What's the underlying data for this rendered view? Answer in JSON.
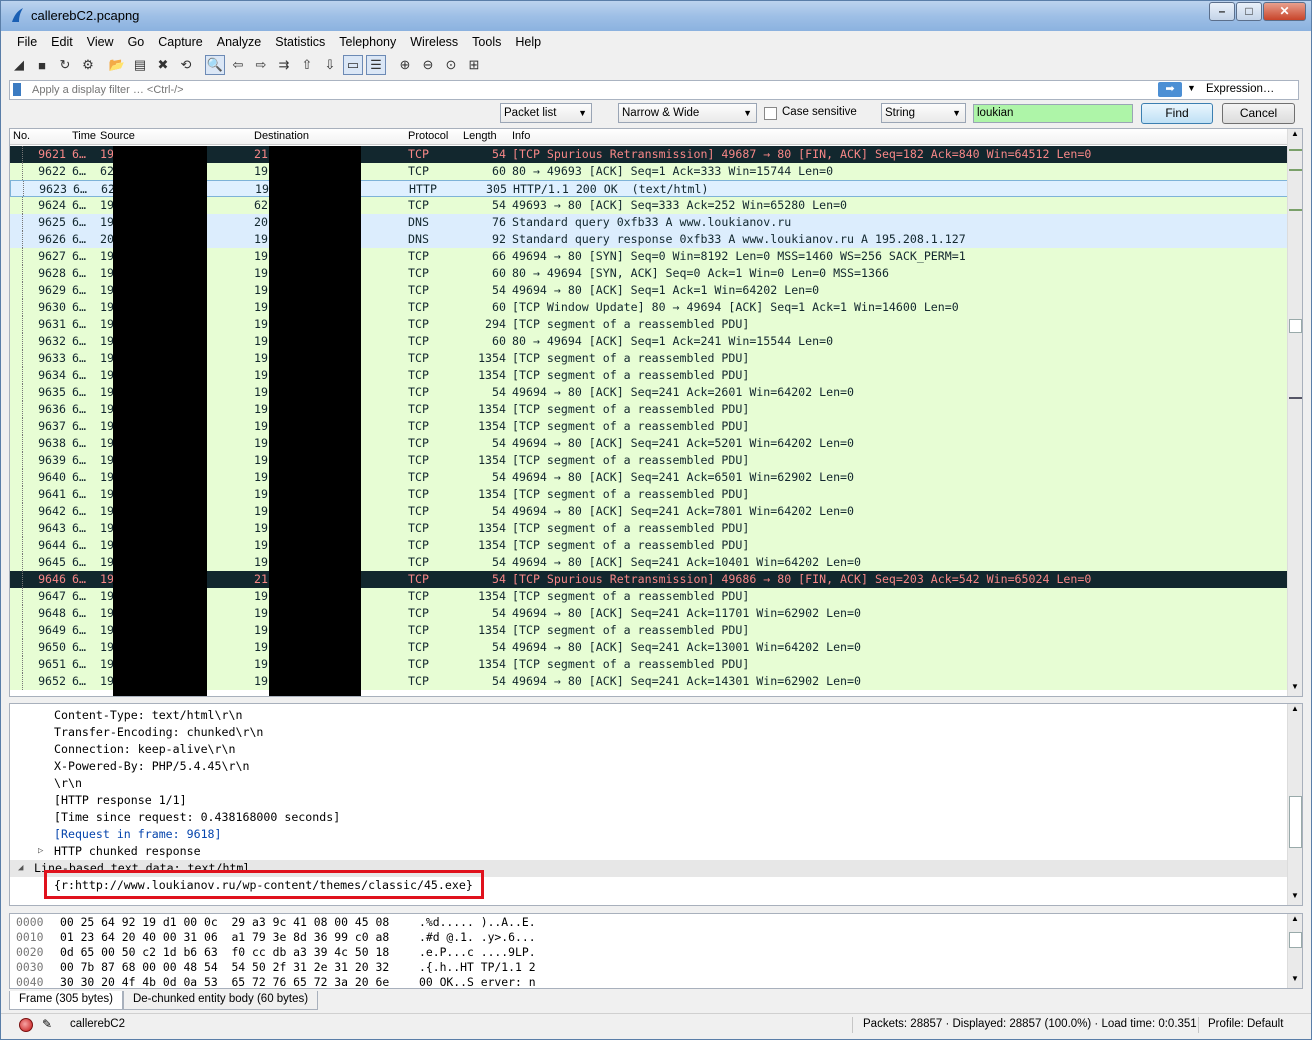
{
  "window": {
    "title": "callerebC2.pcapng",
    "controls": [
      "–",
      "□",
      "✕"
    ]
  },
  "menu": [
    "File",
    "Edit",
    "View",
    "Go",
    "Capture",
    "Analyze",
    "Statistics",
    "Telephony",
    "Wireless",
    "Tools",
    "Help"
  ],
  "toolbar": {
    "icons": [
      "shark-fin-start-icon",
      "stop-icon",
      "restart-icon",
      "options-icon",
      "open-icon",
      "save-icon",
      "close-file-icon",
      "reload-icon",
      "find-packet-icon",
      "back-icon",
      "forward-icon",
      "go-to-packet-icon",
      "first-packet-icon",
      "last-packet-icon",
      "autoscroll-icon",
      "colorize-icon",
      "zoom-in-icon",
      "zoom-out-icon",
      "normal-size-icon",
      "resize-columns-icon"
    ],
    "glyphs": [
      "◢",
      "■",
      "↻",
      "⚙",
      "📂",
      "▤",
      "✖",
      "⟲",
      "🔍",
      "⇦",
      "⇨",
      "⇉",
      "⇧",
      "⇩",
      "▭",
      "☰",
      "⊕",
      "⊖",
      "⊙",
      "⊞"
    ]
  },
  "filter": {
    "placeholder": "Apply a display filter … <Ctrl-/>",
    "arrow": "➡",
    "expression_label": "Expression…"
  },
  "find": {
    "search_in": "Packet list",
    "char_width": "Narrow & Wide",
    "case_label": "Case sensitive",
    "type": "String",
    "value": "loukian",
    "find_label": "Find",
    "cancel_label": "Cancel"
  },
  "columns": {
    "no": "No.",
    "time": "Time",
    "source": "Source",
    "destination": "Destination",
    "protocol": "Protocol",
    "length": "Length",
    "info": "Info"
  },
  "packets": [
    {
      "no": "9621",
      "time": "6…",
      "src": "19",
      "dst": "21",
      "proto": "TCP",
      "len": "54",
      "info": "[TCP Spurious Retransmission] 49687 → 80 [FIN, ACK] Seq=182 Ack=840 Win=64512 Len=0",
      "kind": "bad"
    },
    {
      "no": "9622",
      "time": "6…",
      "src": "62",
      "dst": "19",
      "proto": "TCP",
      "len": "60",
      "info": "80 → 49693 [ACK] Seq=1 Ack=333 Win=15744 Len=0",
      "kind": "tcp"
    },
    {
      "no": "9623",
      "time": "6…",
      "src": "62",
      "dst": "19",
      "proto": "HTTP",
      "len": "305",
      "info": "HTTP/1.1 200 OK  (text/html)",
      "kind": "http"
    },
    {
      "no": "9624",
      "time": "6…",
      "src": "19",
      "dst": "62",
      "proto": "TCP",
      "len": "54",
      "info": "49693 → 80 [ACK] Seq=333 Ack=252 Win=65280 Len=0",
      "kind": "tcp"
    },
    {
      "no": "9625",
      "time": "6…",
      "src": "19",
      "dst": "20",
      "proto": "DNS",
      "len": "76",
      "info": "Standard query 0xfb33 A www.loukianov.ru",
      "kind": "dns"
    },
    {
      "no": "9626",
      "time": "6…",
      "src": "20",
      "dst": "19",
      "proto": "DNS",
      "len": "92",
      "info": "Standard query response 0xfb33 A www.loukianov.ru A 195.208.1.127",
      "kind": "dns"
    },
    {
      "no": "9627",
      "time": "6…",
      "src": "19",
      "dst": "19",
      "proto": "TCP",
      "len": "66",
      "info": "49694 → 80 [SYN] Seq=0 Win=8192 Len=0 MSS=1460 WS=256 SACK_PERM=1",
      "kind": "tcp"
    },
    {
      "no": "9628",
      "time": "6…",
      "src": "19",
      "dst": "19",
      "proto": "TCP",
      "len": "60",
      "info": "80 → 49694 [SYN, ACK] Seq=0 Ack=1 Win=0 Len=0 MSS=1366",
      "kind": "tcp"
    },
    {
      "no": "9629",
      "time": "6…",
      "src": "19",
      "dst": "19",
      "proto": "TCP",
      "len": "54",
      "info": "49694 → 80 [ACK] Seq=1 Ack=1 Win=64202 Len=0",
      "kind": "tcp"
    },
    {
      "no": "9630",
      "time": "6…",
      "src": "19",
      "dst": "19",
      "proto": "TCP",
      "len": "60",
      "info": "[TCP Window Update] 80 → 49694 [ACK] Seq=1 Ack=1 Win=14600 Len=0",
      "kind": "tcp"
    },
    {
      "no": "9631",
      "time": "6…",
      "src": "19",
      "dst": "19",
      "proto": "TCP",
      "len": "294",
      "info": "[TCP segment of a reassembled PDU]",
      "kind": "tcp"
    },
    {
      "no": "9632",
      "time": "6…",
      "src": "19",
      "dst": "19",
      "proto": "TCP",
      "len": "60",
      "info": "80 → 49694 [ACK] Seq=1 Ack=241 Win=15544 Len=0",
      "kind": "tcp"
    },
    {
      "no": "9633",
      "time": "6…",
      "src": "19",
      "dst": "19",
      "proto": "TCP",
      "len": "1354",
      "info": "[TCP segment of a reassembled PDU]",
      "kind": "tcp"
    },
    {
      "no": "9634",
      "time": "6…",
      "src": "19",
      "dst": "19",
      "proto": "TCP",
      "len": "1354",
      "info": "[TCP segment of a reassembled PDU]",
      "kind": "tcp"
    },
    {
      "no": "9635",
      "time": "6…",
      "src": "19",
      "dst": "19",
      "proto": "TCP",
      "len": "54",
      "info": "49694 → 80 [ACK] Seq=241 Ack=2601 Win=64202 Len=0",
      "kind": "tcp"
    },
    {
      "no": "9636",
      "time": "6…",
      "src": "19",
      "dst": "19",
      "proto": "TCP",
      "len": "1354",
      "info": "[TCP segment of a reassembled PDU]",
      "kind": "tcp"
    },
    {
      "no": "9637",
      "time": "6…",
      "src": "19",
      "dst": "19",
      "proto": "TCP",
      "len": "1354",
      "info": "[TCP segment of a reassembled PDU]",
      "kind": "tcp"
    },
    {
      "no": "9638",
      "time": "6…",
      "src": "19",
      "dst": "19",
      "proto": "TCP",
      "len": "54",
      "info": "49694 → 80 [ACK] Seq=241 Ack=5201 Win=64202 Len=0",
      "kind": "tcp"
    },
    {
      "no": "9639",
      "time": "6…",
      "src": "19",
      "dst": "19",
      "proto": "TCP",
      "len": "1354",
      "info": "[TCP segment of a reassembled PDU]",
      "kind": "tcp"
    },
    {
      "no": "9640",
      "time": "6…",
      "src": "19",
      "dst": "19",
      "proto": "TCP",
      "len": "54",
      "info": "49694 → 80 [ACK] Seq=241 Ack=6501 Win=62902 Len=0",
      "kind": "tcp"
    },
    {
      "no": "9641",
      "time": "6…",
      "src": "19",
      "dst": "19",
      "proto": "TCP",
      "len": "1354",
      "info": "[TCP segment of a reassembled PDU]",
      "kind": "tcp"
    },
    {
      "no": "9642",
      "time": "6…",
      "src": "19",
      "dst": "19",
      "proto": "TCP",
      "len": "54",
      "info": "49694 → 80 [ACK] Seq=241 Ack=7801 Win=64202 Len=0",
      "kind": "tcp"
    },
    {
      "no": "9643",
      "time": "6…",
      "src": "19",
      "dst": "19",
      "proto": "TCP",
      "len": "1354",
      "info": "[TCP segment of a reassembled PDU]",
      "kind": "tcp"
    },
    {
      "no": "9644",
      "time": "6…",
      "src": "19",
      "dst": "19",
      "proto": "TCP",
      "len": "1354",
      "info": "[TCP segment of a reassembled PDU]",
      "kind": "tcp"
    },
    {
      "no": "9645",
      "time": "6…",
      "src": "19",
      "dst": "19",
      "proto": "TCP",
      "len": "54",
      "info": "49694 → 80 [ACK] Seq=241 Ack=10401 Win=64202 Len=0",
      "kind": "tcp"
    },
    {
      "no": "9646",
      "time": "6…",
      "src": "19",
      "dst": "21",
      "proto": "TCP",
      "len": "54",
      "info": "[TCP Spurious Retransmission] 49686 → 80 [FIN, ACK] Seq=203 Ack=542 Win=65024 Len=0",
      "kind": "bad"
    },
    {
      "no": "9647",
      "time": "6…",
      "src": "19",
      "dst": "19",
      "proto": "TCP",
      "len": "1354",
      "info": "[TCP segment of a reassembled PDU]",
      "kind": "tcp"
    },
    {
      "no": "9648",
      "time": "6…",
      "src": "19",
      "dst": "19",
      "proto": "TCP",
      "len": "54",
      "info": "49694 → 80 [ACK] Seq=241 Ack=11701 Win=62902 Len=0",
      "kind": "tcp"
    },
    {
      "no": "9649",
      "time": "6…",
      "src": "19",
      "dst": "19",
      "proto": "TCP",
      "len": "1354",
      "info": "[TCP segment of a reassembled PDU]",
      "kind": "tcp"
    },
    {
      "no": "9650",
      "time": "6…",
      "src": "19",
      "dst": "19",
      "proto": "TCP",
      "len": "54",
      "info": "49694 → 80 [ACK] Seq=241 Ack=13001 Win=64202 Len=0",
      "kind": "tcp"
    },
    {
      "no": "9651",
      "time": "6…",
      "src": "19",
      "dst": "19",
      "proto": "TCP",
      "len": "1354",
      "info": "[TCP segment of a reassembled PDU]",
      "kind": "tcp"
    },
    {
      "no": "9652",
      "time": "6…",
      "src": "19",
      "dst": "19",
      "proto": "TCP",
      "len": "54",
      "info": "49694 → 80 [ACK] Seq=241 Ack=14301 Win=62902 Len=0",
      "kind": "tcp"
    }
  ],
  "details": [
    {
      "text": "Content-Type: text/html\\r\\n",
      "indent": "l2"
    },
    {
      "text": "Transfer-Encoding: chunked\\r\\n",
      "indent": "l2"
    },
    {
      "text": "Connection: keep-alive\\r\\n",
      "indent": "l2"
    },
    {
      "text": "X-Powered-By: PHP/5.4.45\\r\\n",
      "indent": "l2"
    },
    {
      "text": "\\r\\n",
      "indent": "l2"
    },
    {
      "text": "[HTTP response 1/1]",
      "indent": "l2"
    },
    {
      "text": "[Time since request: 0.438168000 seconds]",
      "indent": "l2"
    },
    {
      "text": "[Request in frame: 9618]",
      "indent": "l2",
      "link": true
    },
    {
      "text": "HTTP chunked response",
      "indent": "l2",
      "tri": "▷"
    },
    {
      "text": "Line-based text data: text/html",
      "indent": "l1",
      "tri": "◢",
      "sel": true
    },
    {
      "text": "{r:http://www.loukianov.ru/wp-content/themes/classic/45.exe}",
      "indent": "l2"
    }
  ],
  "bytes": [
    {
      "off": "0000",
      "hex": "00 25 64 92 19 d1 00 0c  29 a3 9c 41 08 00 45 08",
      "ascii": ".%d..... )..A..E."
    },
    {
      "off": "0010",
      "hex": "01 23 64 20 40 00 31 06  a1 79 3e 8d 36 99 c0 a8",
      "ascii": ".#d @.1. .y>.6..."
    },
    {
      "off": "0020",
      "hex": "0d 65 00 50 c2 1d b6 63  f0 cc db a3 39 4c 50 18",
      "ascii": ".e.P...c ....9LP."
    },
    {
      "off": "0030",
      "hex": "00 7b 87 68 00 00 48 54  54 50 2f 31 2e 31 20 32",
      "ascii": ".{.h..HT TP/1.1 2"
    },
    {
      "off": "0040",
      "hex": "30 30 20 4f 4b 0d 0a 53  65 72 76 65 72 3a 20 6e",
      "ascii": "00 OK..S erver: n"
    }
  ],
  "bottom_tabs": [
    "Frame (305 bytes)",
    "De-chunked entity body (60 bytes)"
  ],
  "status": {
    "file": "callerebC2",
    "packets": "Packets: 28857 · Displayed: 28857 (100.0%) · Load time: 0:0.351",
    "profile": "Profile: Default"
  }
}
